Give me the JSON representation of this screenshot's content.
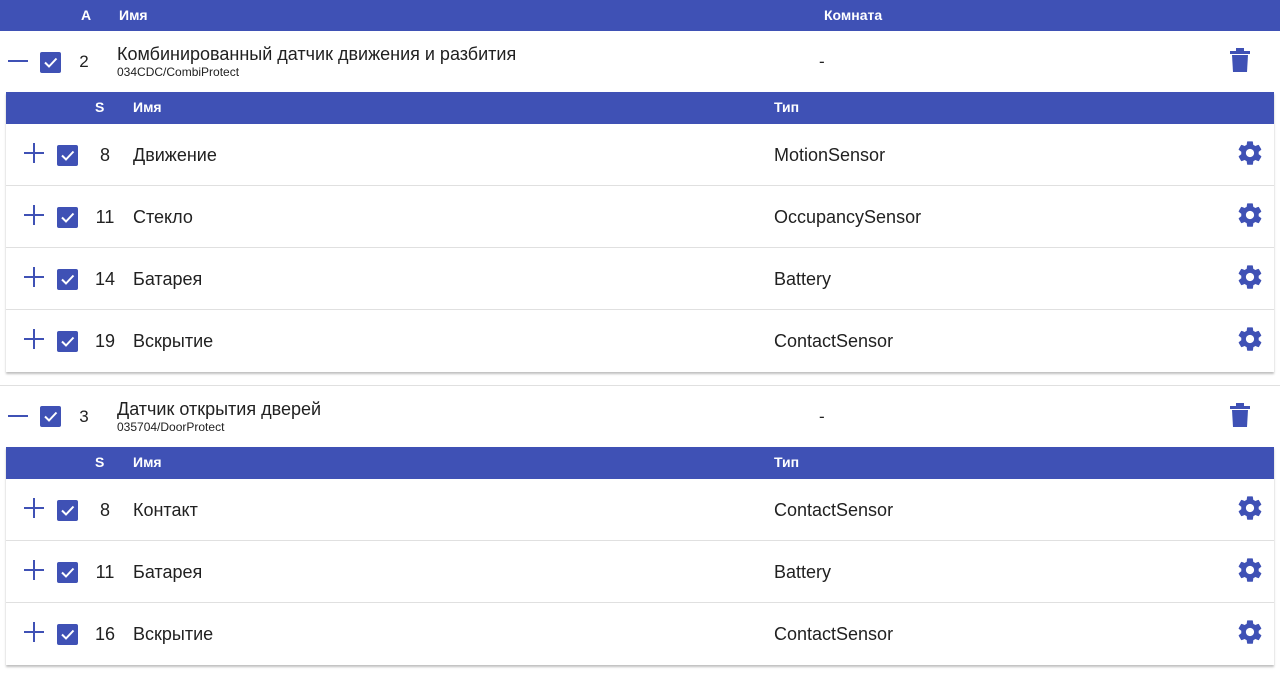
{
  "header": {
    "col_a": "A",
    "col_name": "Имя",
    "col_room": "Комната"
  },
  "sub_header": {
    "col_s": "S",
    "col_name": "Имя",
    "col_type": "Тип"
  },
  "colors": {
    "accent": "#3f51b5"
  },
  "devices": [
    {
      "address": "2",
      "name": "Комбинированный датчик движения и разбития",
      "serial": "034CDC/CombiProtect",
      "room": "-",
      "sensors": [
        {
          "s": "8",
          "name": "Движение",
          "type": "MotionSensor"
        },
        {
          "s": "11",
          "name": "Стекло",
          "type": "OccupancySensor"
        },
        {
          "s": "14",
          "name": "Батарея",
          "type": "Battery"
        },
        {
          "s": "19",
          "name": "Вскрытие",
          "type": "ContactSensor"
        }
      ]
    },
    {
      "address": "3",
      "name": "Датчик открытия дверей",
      "serial": "035704/DoorProtect",
      "room": "-",
      "sensors": [
        {
          "s": "8",
          "name": "Контакт",
          "type": "ContactSensor"
        },
        {
          "s": "11",
          "name": "Батарея",
          "type": "Battery"
        },
        {
          "s": "16",
          "name": "Вскрытие",
          "type": "ContactSensor"
        }
      ]
    }
  ],
  "icons": {
    "collapse": "minus-icon",
    "expand": "plus-icon",
    "delete": "trash-icon",
    "settings": "gear-icon",
    "checked": "checkbox-checked-icon"
  }
}
